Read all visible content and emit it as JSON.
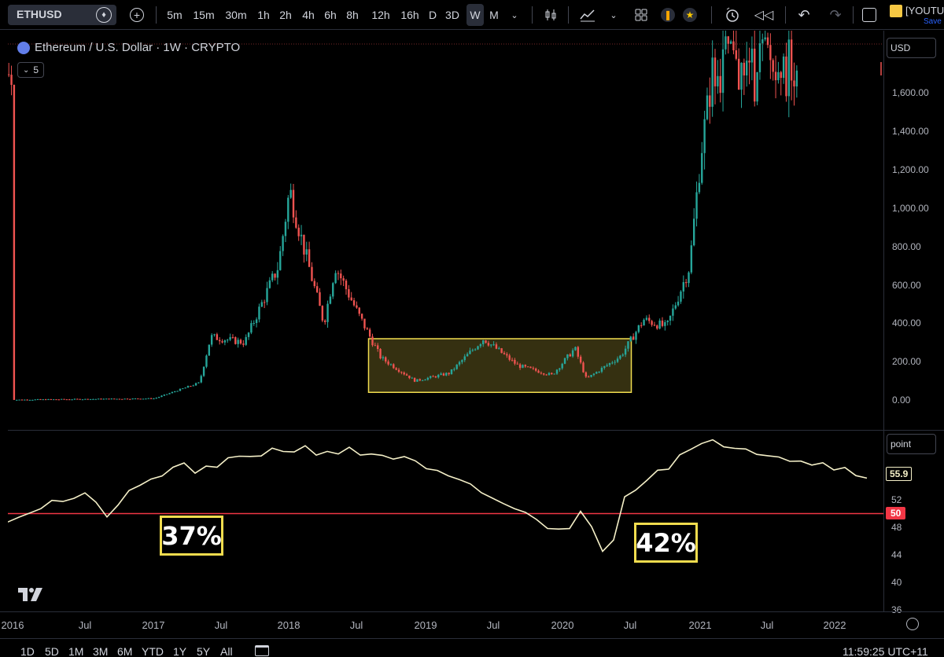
{
  "toolbar": {
    "symbol": "ETHUSD",
    "intervals": [
      "5m",
      "15m",
      "30m",
      "1h",
      "2h",
      "4h",
      "6h",
      "8h",
      "12h",
      "16h",
      "D",
      "3D",
      "W",
      "M"
    ],
    "active_interval": "W",
    "layout_name": "[YOUTU",
    "save_label": "Save",
    "icons": [
      "diamond-icon",
      "plus-circle-icon",
      "chevron-down-icon",
      "candles-icon",
      "indicators-icon",
      "layout-grid-icon",
      "alert-icon",
      "star-icon",
      "replay-alarm-icon",
      "rewind-icon",
      "undo-icon",
      "redo-icon",
      "fullscreen-icon"
    ]
  },
  "legend": {
    "title": "Ethereum / U.S. Dollar · 1W · CRYPTO",
    "collapsed_count": "5"
  },
  "price_axis": {
    "currency": "USD",
    "labels": [
      "1,600.00",
      "1,400.00",
      "1,200.00",
      "1,000.00",
      "800.00",
      "600.00",
      "400.00",
      "200.00",
      "0.00"
    ]
  },
  "oscillator": {
    "scale_label": "point",
    "current_value": "55.9",
    "level_value": "50",
    "labels": [
      "52",
      "48",
      "44",
      "40",
      "36"
    ],
    "annotations": [
      "37%",
      "42%"
    ]
  },
  "time_axis": {
    "labels": [
      "2016",
      "Jul",
      "2017",
      "Jul",
      "2018",
      "Jul",
      "2019",
      "Jul",
      "2020",
      "Jul",
      "2021",
      "Jul",
      "2022"
    ]
  },
  "bottom_bar": {
    "ranges": [
      "1D",
      "5D",
      "1M",
      "3M",
      "6M",
      "YTD",
      "1Y",
      "5Y",
      "All"
    ],
    "clock": "11:59:25 UTC+11"
  },
  "colors": {
    "up": "#26a69a",
    "down": "#ef5350",
    "highlight": "#f0dc4e",
    "line": "#f5f0c8",
    "level": "#f23645"
  },
  "chart_data": {
    "type": "candlestick",
    "interval": "1W",
    "x_range": [
      "2016-01",
      "2022-06"
    ],
    "y_range": [
      0,
      1700
    ],
    "approx_weekly_close": [
      {
        "date": "2016-01",
        "close": 1
      },
      {
        "date": "2017-01",
        "close": 8
      },
      {
        "date": "2017-05",
        "close": 90
      },
      {
        "date": "2017-06",
        "close": 330
      },
      {
        "date": "2017-09",
        "close": 300
      },
      {
        "date": "2017-12",
        "close": 700
      },
      {
        "date": "2018-01",
        "close": 1100
      },
      {
        "date": "2018-02",
        "close": 850
      },
      {
        "date": "2018-04",
        "close": 400
      },
      {
        "date": "2018-05",
        "close": 700
      },
      {
        "date": "2018-07",
        "close": 450
      },
      {
        "date": "2018-09",
        "close": 220
      },
      {
        "date": "2018-12",
        "close": 100
      },
      {
        "date": "2019-03",
        "close": 140
      },
      {
        "date": "2019-06",
        "close": 320
      },
      {
        "date": "2019-09",
        "close": 180
      },
      {
        "date": "2019-12",
        "close": 130
      },
      {
        "date": "2020-02",
        "close": 270
      },
      {
        "date": "2020-03",
        "close": 110
      },
      {
        "date": "2020-06",
        "close": 230
      },
      {
        "date": "2020-08",
        "close": 420
      },
      {
        "date": "2020-10",
        "close": 380
      },
      {
        "date": "2020-12",
        "close": 700
      },
      {
        "date": "2021-01",
        "close": 1300
      },
      {
        "date": "2021-02",
        "close": 1700
      }
    ],
    "highlight_box": {
      "from": "2018-08",
      "to": "2020-07",
      "low": 40,
      "high": 320
    },
    "oscillator_series": [
      {
        "date": "2016-01",
        "value": 49.5
      },
      {
        "date": "2016-04",
        "value": 51.5
      },
      {
        "date": "2016-07",
        "value": 52.5
      },
      {
        "date": "2016-09",
        "value": 50
      },
      {
        "date": "2016-12",
        "value": 54
      },
      {
        "date": "2017-03",
        "value": 57
      },
      {
        "date": "2017-06",
        "value": 56
      },
      {
        "date": "2017-09",
        "value": 58.5
      },
      {
        "date": "2018-01",
        "value": 59.5
      },
      {
        "date": "2018-06",
        "value": 59
      },
      {
        "date": "2018-10",
        "value": 58.5
      },
      {
        "date": "2019-03",
        "value": 55
      },
      {
        "date": "2019-08",
        "value": 51.5
      },
      {
        "date": "2019-11",
        "value": 48.5
      },
      {
        "date": "2020-02",
        "value": 48
      },
      {
        "date": "2020-03",
        "value": 51
      },
      {
        "date": "2020-05",
        "value": 42
      },
      {
        "date": "2020-06",
        "value": 52.5
      },
      {
        "date": "2020-09",
        "value": 56
      },
      {
        "date": "2020-12",
        "value": 59
      },
      {
        "date": "2021-03",
        "value": 60.5
      },
      {
        "date": "2021-07",
        "value": 59
      },
      {
        "date": "2021-11",
        "value": 57.5
      },
      {
        "date": "2022-04",
        "value": 55.9
      }
    ],
    "level": 50,
    "osc_y_range": [
      36,
      60
    ]
  }
}
